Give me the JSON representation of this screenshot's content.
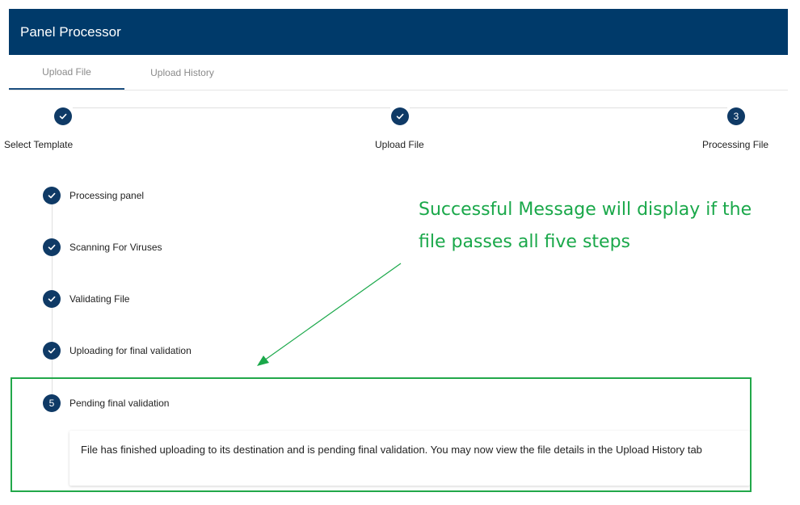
{
  "app": {
    "title": "Panel Processor"
  },
  "tabs": [
    {
      "label": "Upload File"
    },
    {
      "label": "Upload History"
    }
  ],
  "stepper": {
    "steps": [
      {
        "label": "Select Template",
        "status": "complete",
        "number": ""
      },
      {
        "label": "Upload File",
        "status": "complete",
        "number": ""
      },
      {
        "label": "Processing File",
        "status": "active",
        "number": "3"
      }
    ]
  },
  "processing_steps": [
    {
      "label": "Processing panel",
      "status": "complete",
      "number": ""
    },
    {
      "label": "Scanning For Viruses",
      "status": "complete",
      "number": ""
    },
    {
      "label": "Validating File",
      "status": "complete",
      "number": ""
    },
    {
      "label": "Uploading for final validation",
      "status": "complete",
      "number": ""
    },
    {
      "label": "Pending final validation",
      "status": "active",
      "number": "5"
    }
  ],
  "message": {
    "text": "File has finished uploading to its destination and is pending final validation. You may now view the file details in the Upload History tab"
  },
  "annotation": {
    "text": "Successful Message will display if the file passes all five steps"
  },
  "colors": {
    "header": "#003a6a",
    "step_circle": "#0f3a66",
    "annotation": "#1aa84a"
  }
}
